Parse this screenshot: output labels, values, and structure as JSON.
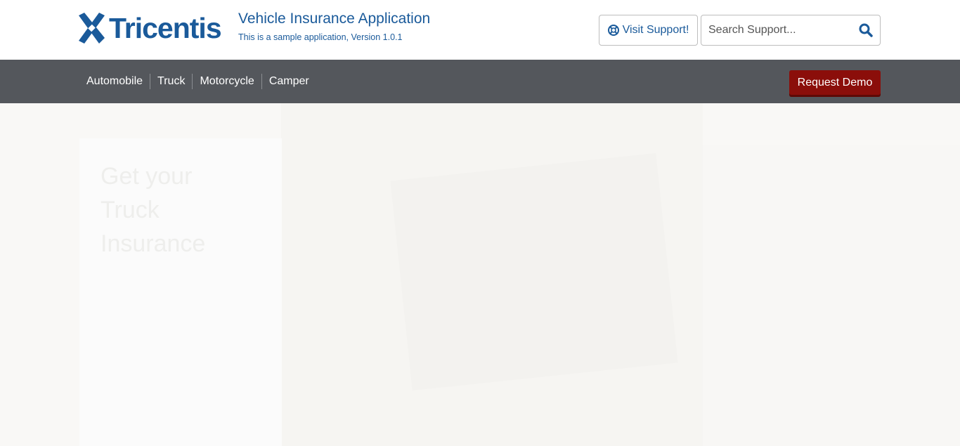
{
  "brand": {
    "logo_text": "Tricentis",
    "logo_icon": "tricentis-x-logo",
    "color": "#1a5a9a"
  },
  "header": {
    "app_title": "Vehicle Insurance Application",
    "app_subtitle": "This is a sample application, Version 1.0.1",
    "support_button": {
      "label": "Visit Support!",
      "icon": "lifebuoy-icon"
    },
    "search": {
      "placeholder": "Search Support...",
      "value": "",
      "icon": "search-icon"
    }
  },
  "navbar": {
    "items": [
      {
        "label": "Automobile"
      },
      {
        "label": "Truck"
      },
      {
        "label": "Motorcycle"
      },
      {
        "label": "Camper"
      }
    ],
    "demo_button": "Request Demo",
    "background_color": "#54575c",
    "demo_color": "#8b0e0a"
  },
  "main": {
    "intro_heading": "Get your Truck Insurance",
    "intro_text": ""
  }
}
